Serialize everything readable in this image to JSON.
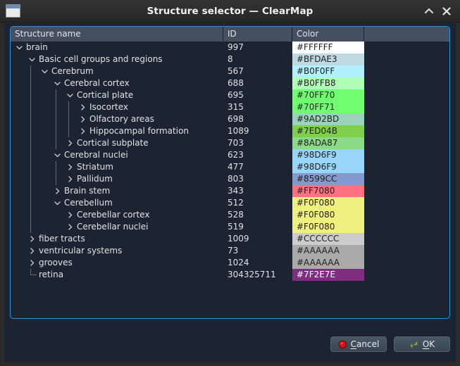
{
  "window": {
    "title": "Structure selector — ClearMap",
    "icon": "window-icon",
    "shade_icon": "chevron-up-icon",
    "close_icon": "close-icon"
  },
  "table": {
    "columns": [
      "Structure name",
      "ID",
      "Color",
      ""
    ],
    "rows": [
      {
        "name": "brain",
        "id": "997",
        "color": "#FFFFFF",
        "depth": 0,
        "state": "expanded",
        "text": "dark"
      },
      {
        "name": "Basic cell groups and regions",
        "id": "8",
        "color": "#BFDAE3",
        "depth": 1,
        "state": "expanded",
        "text": "dark"
      },
      {
        "name": "Cerebrum",
        "id": "567",
        "color": "#B0F0FF",
        "depth": 2,
        "state": "expanded",
        "text": "dark"
      },
      {
        "name": "Cerebral cortex",
        "id": "688",
        "color": "#B0FFB8",
        "depth": 3,
        "state": "expanded",
        "text": "dark"
      },
      {
        "name": "Cortical plate",
        "id": "695",
        "color": "#70FF70",
        "depth": 4,
        "state": "expanded",
        "text": "dark"
      },
      {
        "name": "Isocortex",
        "id": "315",
        "color": "#70FF71",
        "depth": 5,
        "state": "collapsed",
        "text": "dark"
      },
      {
        "name": "Olfactory areas",
        "id": "698",
        "color": "#9AD2BD",
        "depth": 5,
        "state": "collapsed",
        "text": "dark"
      },
      {
        "name": "Hippocampal formation",
        "id": "1089",
        "color": "#7ED04B",
        "depth": 5,
        "state": "collapsed",
        "text": "dark"
      },
      {
        "name": "Cortical subplate",
        "id": "703",
        "color": "#8ADA87",
        "depth": 4,
        "state": "collapsed",
        "text": "dark"
      },
      {
        "name": "Cerebral nuclei",
        "id": "623",
        "color": "#98D6F9",
        "depth": 3,
        "state": "expanded",
        "text": "dark"
      },
      {
        "name": "Striatum",
        "id": "477",
        "color": "#98D6F9",
        "depth": 4,
        "state": "collapsed",
        "text": "dark"
      },
      {
        "name": "Pallidum",
        "id": "803",
        "color": "#8599CC",
        "depth": 4,
        "state": "collapsed",
        "text": "dark"
      },
      {
        "name": "Brain stem",
        "id": "343",
        "color": "#FF7080",
        "depth": 3,
        "state": "collapsed",
        "text": "dark"
      },
      {
        "name": "Cerebellum",
        "id": "512",
        "color": "#F0F080",
        "depth": 3,
        "state": "expanded",
        "text": "dark"
      },
      {
        "name": "Cerebellar cortex",
        "id": "528",
        "color": "#F0F080",
        "depth": 4,
        "state": "collapsed",
        "text": "dark"
      },
      {
        "name": "Cerebellar nuclei",
        "id": "519",
        "color": "#F0F080",
        "depth": 4,
        "state": "collapsed",
        "text": "dark"
      },
      {
        "name": "fiber tracts",
        "id": "1009",
        "color": "#CCCCCC",
        "depth": 1,
        "state": "collapsed",
        "text": "dark"
      },
      {
        "name": "ventricular systems",
        "id": "73",
        "color": "#AAAAAA",
        "depth": 1,
        "state": "collapsed",
        "text": "dark"
      },
      {
        "name": "grooves",
        "id": "1024",
        "color": "#AAAAAA",
        "depth": 1,
        "state": "collapsed",
        "text": "dark"
      },
      {
        "name": "retina",
        "id": "304325711",
        "color": "#7F2E7E",
        "depth": 1,
        "state": "leaf",
        "text": "light"
      }
    ]
  },
  "buttons": {
    "cancel": {
      "label": "Cancel",
      "mnemonic": "C",
      "icon": "cancel-circle-icon",
      "icon_color": "#DD1111"
    },
    "ok": {
      "label": "OK",
      "mnemonic": "O",
      "icon": "enter-arrow-icon",
      "icon_color": "#8B9B52"
    }
  },
  "theme": {
    "panel_border": "#2F8FD8",
    "header_bg": "#44505F",
    "body_bg": "#1B2430",
    "titlebar_bg": "#2D2D2D"
  }
}
